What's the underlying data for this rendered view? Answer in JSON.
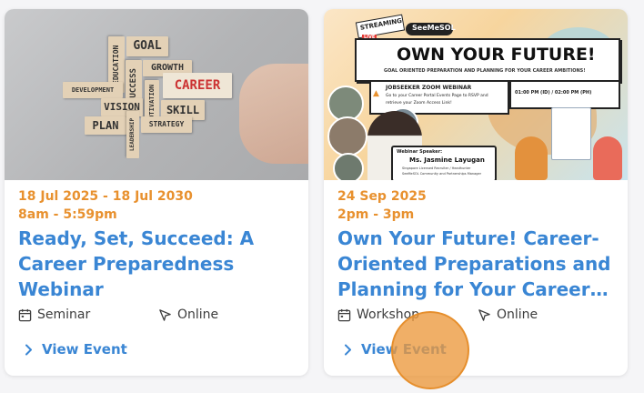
{
  "cards": [
    {
      "image": {
        "words": [
          "GOAL",
          "EDUCATION",
          "SUCCESS",
          "GROWTH",
          "DEVELOPMENT",
          "CAREER",
          "VISION",
          "MOTIVATION",
          "SKILL",
          "PLAN",
          "STRATEGY",
          "LEADERSHIP"
        ]
      },
      "date": "18 Jul 2025 - 18 Jul 2030",
      "time": "8am - 5:59pm",
      "title": "Ready, Set, Succeed: A Career Preparedness Webinar",
      "event_type": "Seminar",
      "mode": "Online",
      "link_label": "View Event"
    },
    {
      "image": {
        "streaming": "STREAMING",
        "live": "LIVE",
        "brand": "SeeMeSOL",
        "headline": "OWN YOUR FUTURE!",
        "tagline": "GOAL ORIENTED PREPARATION AND PLANNING FOR YOUR CAREER AMBITIONS!",
        "time_text": "01:00 PM (ID) / 02:00 PM (PH)",
        "webinar_label": "JOBSEEKER ZOOM WEBINAR",
        "instructions_line1": "Go to your Career Portal Events Page to RSVP and",
        "instructions_line2": "retrieve your Zoom Access Link!",
        "speaker_label": "Webinar Speaker:",
        "speaker_name": "Ms. Jasmine Layugan",
        "speaker_role1": "Singapore Licensed Recruiter / Headhunter",
        "speaker_role2": "SeeMeSOL Community and Partnerships Manager"
      },
      "date": "24 Sep 2025",
      "time": "2pm - 3pm",
      "title": "Own Your Future! Career-Oriented Preparations and Planning for Your Career…",
      "event_type": "Workshop",
      "mode": "Online",
      "link_label": "View Event"
    }
  ],
  "colors": {
    "accent_blue": "#3a86d4",
    "date_orange": "#e8912f",
    "cursor_orange": "#ec983c"
  }
}
